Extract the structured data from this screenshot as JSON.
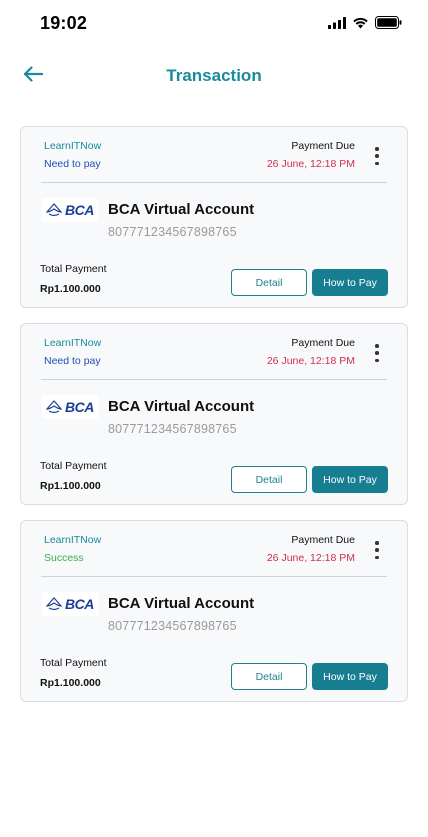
{
  "status_bar": {
    "time": "19:02",
    "icons": [
      "signal-icon",
      "wifi-icon",
      "battery-icon"
    ]
  },
  "header": {
    "title": "Transaction",
    "back_icon": "arrow-left-icon"
  },
  "colors": {
    "accent": "#1a8a9c",
    "button_primary": "#177e91",
    "pending": "#1f4fb0",
    "success": "#33b24a",
    "due_date": "#d0304b",
    "bank_blue": "#1c3f94"
  },
  "transactions": [
    {
      "merchant": "LearnITNow",
      "status": "Need to pay",
      "due_label": "Payment Due",
      "due_date": "26 June, 12:18 PM",
      "bank_logo_text": "BCA",
      "account_name": "BCA Virtual Account",
      "account_number": "807771234567898765",
      "total_label": "Total Payment",
      "total_amount": "Rp1.100.000",
      "detail_label": "Detail",
      "how_to_pay_label": "How to Pay"
    },
    {
      "merchant": "LearnITNow",
      "status": "Need to pay",
      "due_label": "Payment Due",
      "due_date": "26 June, 12:18 PM",
      "bank_logo_text": "BCA",
      "account_name": "BCA Virtual Account",
      "account_number": "807771234567898765",
      "total_label": "Total Payment",
      "total_amount": "Rp1.100.000",
      "detail_label": "Detail",
      "how_to_pay_label": "How to Pay"
    },
    {
      "merchant": "LearnITNow",
      "status": "Success",
      "due_label": "Payment Due",
      "due_date": "26 June, 12:18 PM",
      "bank_logo_text": "BCA",
      "account_name": "BCA Virtual Account",
      "account_number": "807771234567898765",
      "total_label": "Total Payment",
      "total_amount": "Rp1.100.000",
      "detail_label": "Detail",
      "how_to_pay_label": "How to Pay"
    }
  ]
}
